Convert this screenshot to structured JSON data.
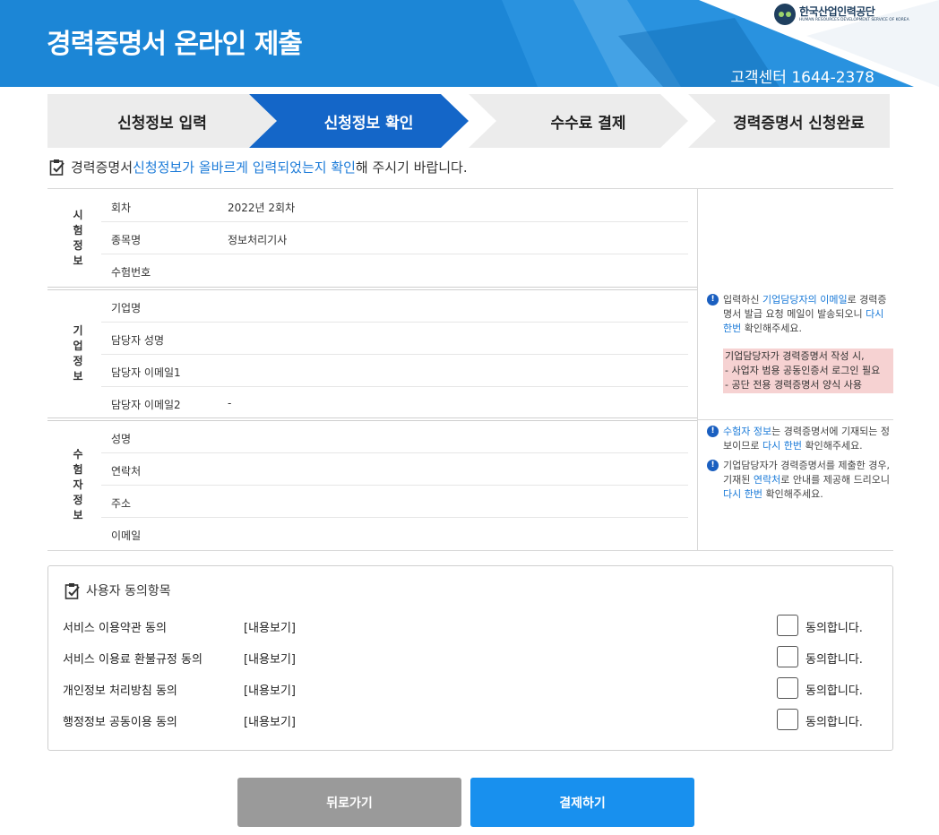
{
  "header": {
    "title": "경력증명서 온라인 제출",
    "customer_center": "고객센터 1644-2378",
    "logo_name": "한국산업인력공단",
    "logo_sub": "HUMAN RESOURCES DEVELOPMENT SERVICE OF KOREA",
    "colors": {
      "primary": "#1c86d6",
      "active_step": "#1466c8",
      "button_primary": "#1890ee",
      "button_secondary": "#9a9a9a",
      "warning_bg": "#f6d2d2",
      "link": "#1a7ad8"
    }
  },
  "steps": [
    {
      "label": "신청정보 입력",
      "active": false
    },
    {
      "label": "신청정보 확인",
      "active": true
    },
    {
      "label": "수수료 결제",
      "active": false
    },
    {
      "label": "경력증명서 신청완료",
      "active": false
    }
  ],
  "notice": {
    "prefix": "경력증명서 ",
    "highlight": "신청정보가 올바르게 입력되었는지 확인",
    "suffix": "해 주시기 바랍니다."
  },
  "sections": {
    "exam": {
      "label": "시험정보",
      "rows": [
        {
          "key": "회차",
          "value": "2022년 2회차"
        },
        {
          "key": "종목명",
          "value": "정보처리기사"
        },
        {
          "key": "수험번호",
          "value": ""
        }
      ]
    },
    "company": {
      "label": "기업정보",
      "rows": [
        {
          "key": "기업명",
          "value": ""
        },
        {
          "key": "담당자 성명",
          "value": ""
        },
        {
          "key": "담당자 이메일1",
          "value": ""
        },
        {
          "key": "담당자 이메일2",
          "value": "-"
        }
      ]
    },
    "examinee": {
      "label": "수험자정보",
      "rows": [
        {
          "key": "성명",
          "value": ""
        },
        {
          "key": "연락처",
          "value": ""
        },
        {
          "key": "주소",
          "value": ""
        },
        {
          "key": "이메일",
          "value": ""
        }
      ]
    }
  },
  "side_notes": {
    "company_note": {
      "t1": "입력하신 ",
      "h1": "기업담당자의 이메일",
      "t2": "로 경력증명서 발급 요청 메일이 발송되오니 ",
      "h2": "다시 한번",
      "t3": " 확인해주세요."
    },
    "company_warning": [
      "기업담당자가 경력증명서 작성 시,",
      "- 사업자 범용 공동인증서 로그인 필요",
      "- 공단 전용 경력증명서 양식 사용"
    ],
    "examinee_note1": {
      "h1": "수험자 정보",
      "t1": "는 경력증명서에 기재되는 정보이므로 ",
      "h2": "다시 한번",
      "t2": " 확인해주세요."
    },
    "examinee_note2": {
      "t1": "기업담당자가 경력증명서를 제출한 경우, 기재된 ",
      "h1": "연락처",
      "t2": "로 안내를 제공해 드리오니 ",
      "h2": "다시 한번",
      "t3": " 확인해주세요."
    }
  },
  "agreement": {
    "title": "사용자 동의항목",
    "items": [
      {
        "label": "서비스 이용약관 동의",
        "view": "[내용보기]",
        "agree_text": "동의합니다.",
        "checked": false
      },
      {
        "label": "서비스 이용료 환불규정 동의",
        "view": "[내용보기]",
        "agree_text": "동의합니다.",
        "checked": false
      },
      {
        "label": "개인정보 처리방침 동의",
        "view": "[내용보기]",
        "agree_text": "동의합니다.",
        "checked": false
      },
      {
        "label": "행정정보 공동이용 동의",
        "view": "[내용보기]",
        "agree_text": "동의합니다.",
        "checked": false
      }
    ]
  },
  "buttons": {
    "back": "뒤로가기",
    "pay": "결제하기"
  }
}
